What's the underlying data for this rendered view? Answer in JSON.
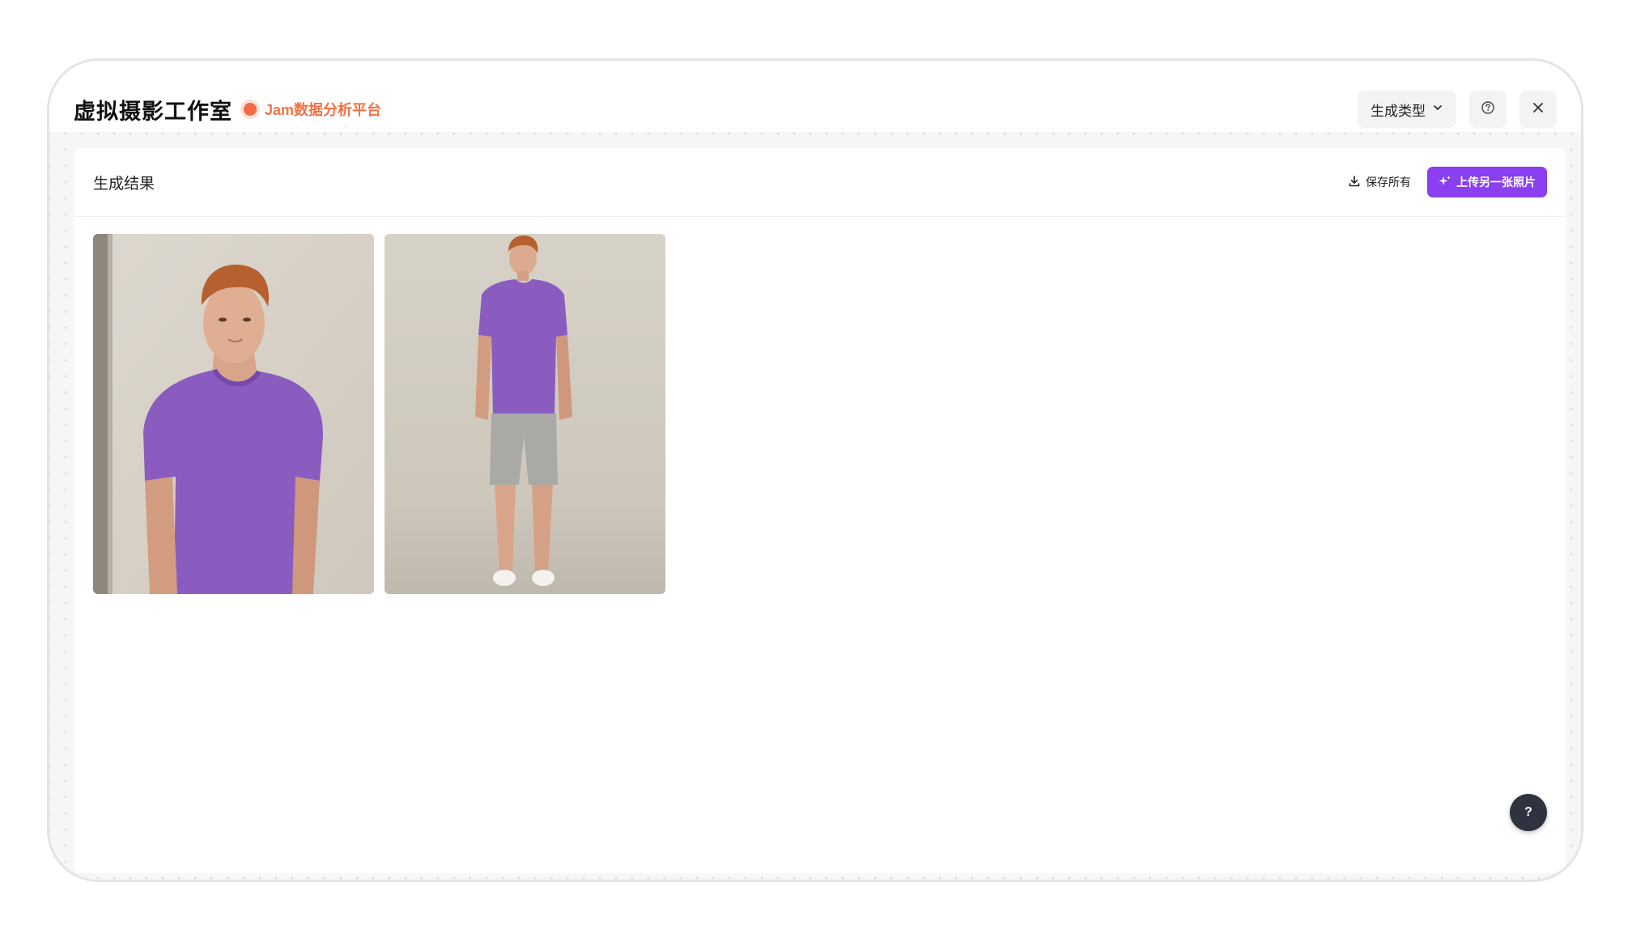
{
  "header": {
    "title": "虚拟摄影工作室",
    "platform_name": "Jam数据分析平台",
    "type_select_label": "生成类型",
    "help_icon": "question-circle-icon",
    "close_icon": "close-icon"
  },
  "results": {
    "title": "生成结果",
    "save_all_label": "保存所有",
    "upload_label": "上传另一张照片",
    "images": [
      {
        "name": "result-image-1"
      },
      {
        "name": "result-image-2"
      }
    ]
  },
  "fab": {
    "label": "?"
  },
  "colors": {
    "accent": "#8a3ff0",
    "platform": "#f07246",
    "fab": "#2f3340"
  }
}
